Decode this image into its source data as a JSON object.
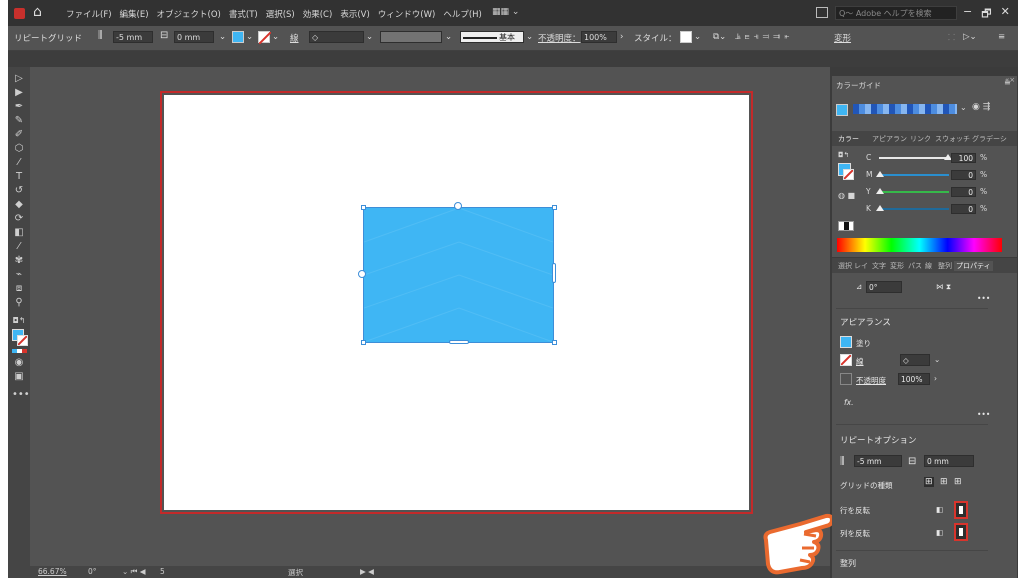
{
  "menubar": {
    "app_icon": "ai-logo-icon",
    "menus": [
      "ファイル(F)",
      "編集(E)",
      "オブジェクト(O)",
      "書式(T)",
      "選択(S)",
      "効果(C)",
      "表示(V)",
      "ウィンドウ(W)",
      "ヘルプ(H)"
    ],
    "search_placeholder": "Q～ Adobe ヘルプを検索",
    "window_controls": [
      "−",
      "🗗",
      "✕"
    ]
  },
  "controlbar": {
    "title": "リピートグリッド",
    "h_spacing": "-5 mm",
    "v_spacing": "0 mm",
    "stroke_label": "線",
    "stroke_style": "基本",
    "opacity_label": "不透明度：",
    "opacity_value": "100%",
    "style_label": "スタイル：",
    "transform_label": "変形"
  },
  "canvas": {
    "fill_color": "#3fb6f4",
    "artboard_border": "#c32a2a"
  },
  "statusbar": {
    "zoom": "66.67%",
    "rotation": "0°",
    "artboard_nav": "5",
    "tool": "選択"
  },
  "color_guide": {
    "tab": "カラーガイド"
  },
  "color_panel": {
    "tabs": [
      "カラー",
      "アピアラン",
      "リンク",
      "スウォッチ",
      "グラデーシ"
    ],
    "channels": [
      {
        "label": "C",
        "value": "100",
        "color": "#2a9fd8"
      },
      {
        "label": "M",
        "value": "0",
        "color": "#d0449b"
      },
      {
        "label": "Y",
        "value": "0",
        "color": "#e0d82a"
      },
      {
        "label": "K",
        "value": "0",
        "color": "#111111"
      }
    ],
    "percent": "%"
  },
  "properties": {
    "tabs": [
      "選択",
      "レイ",
      "文字",
      "変形",
      "パス",
      "線",
      "整列",
      "プロパティ"
    ],
    "rotate_value": "0°",
    "appearance_heading": "アピアランス",
    "fill_label": "塗り",
    "stroke_label": "線",
    "opacity_label": "不透明度",
    "opacity_value": "100%",
    "fx_label": "fx.",
    "repeat_heading": "リピートオプション",
    "h_spacing": "-5 mm",
    "v_spacing": "0 mm",
    "grid_type_label": "グリッドの種類",
    "flip_rows_label": "行を反転",
    "flip_cols_label": "列を反転",
    "align_heading": "整列"
  },
  "annotation": {
    "pointer": "hand-pointer-icon",
    "highlight_color": "#d8342c"
  }
}
